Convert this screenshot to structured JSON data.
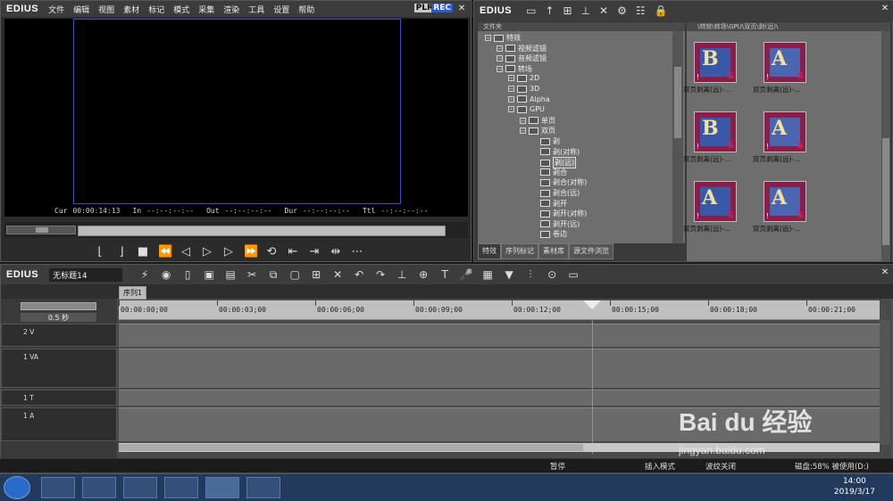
{
  "player": {
    "logo": "EDIUS",
    "menu": [
      "文件",
      "编辑",
      "视图",
      "素材",
      "标记",
      "模式",
      "采集",
      "渲染",
      "工具",
      "设置",
      "帮助"
    ],
    "plr": "PLR",
    "rec": "REC",
    "timecodes": {
      "cur_label": "Cur",
      "cur": "00:00:14:13",
      "in_label": "In",
      "in": "--:--:--:--",
      "out_label": "Out",
      "out": "--:--:--:--",
      "dur_label": "Dur",
      "dur": "--:--:--:--",
      "ttl_label": "Ttl",
      "ttl": "--:--:--:--"
    }
  },
  "library": {
    "logo": "EDIUS",
    "tree_header": "文件夹",
    "tree": [
      {
        "label": "特效",
        "indent": 0
      },
      {
        "label": "视频滤镜",
        "indent": 1
      },
      {
        "label": "音频滤镜",
        "indent": 1
      },
      {
        "label": "转场",
        "indent": 1
      },
      {
        "label": "2D",
        "indent": 2
      },
      {
        "label": "3D",
        "indent": 2
      },
      {
        "label": "Alpha",
        "indent": 2
      },
      {
        "label": "GPU",
        "indent": 2
      },
      {
        "label": "单页",
        "indent": 3
      },
      {
        "label": "双页",
        "indent": 3
      },
      {
        "label": "剥",
        "indent": 4
      },
      {
        "label": "剥(对称)",
        "indent": 4
      },
      {
        "label": "剥(远)",
        "indent": 4,
        "selected": true
      },
      {
        "label": "剥合",
        "indent": 4
      },
      {
        "label": "剥合(对称)",
        "indent": 4
      },
      {
        "label": "剥合(远)",
        "indent": 4
      },
      {
        "label": "剥开",
        "indent": 4
      },
      {
        "label": "剥开(对称)",
        "indent": 4
      },
      {
        "label": "剥开(远)",
        "indent": 4
      },
      {
        "label": "卷边",
        "indent": 4
      }
    ],
    "tabs": [
      "特效",
      "序列标记",
      "素材库",
      "源文件浏览"
    ],
    "bin_path": "\\特效\\转场\\GPU\\双页\\剥(远)\\",
    "thumbs": [
      {
        "letter": "B",
        "label": "双页剥离(远)-..."
      },
      {
        "letter": "A",
        "label": "双页剥离(远)-..."
      },
      {
        "letter": "B",
        "label": "双页剥离(远)-..."
      },
      {
        "letter": "A",
        "label": "双页剥离(远)-..."
      },
      {
        "letter": "A",
        "label": "双页剥离(远)-..."
      },
      {
        "letter": "A",
        "label": "双页剥离(远)-..."
      }
    ]
  },
  "timeline": {
    "logo": "EDIUS",
    "project_name": "无标题14",
    "sequence_tab": "序列1",
    "zoom": "0.5 秒",
    "ruler": [
      "00:00:00;00",
      "00:00:03;00",
      "00:00:06;00",
      "00:00:09;00",
      "00:00:12;00",
      "00:00:15;00",
      "00:00:18;00",
      "00:00:21;00"
    ],
    "tracks": [
      {
        "name": "2 V"
      },
      {
        "name": "1 VA"
      },
      {
        "name": "1 T"
      },
      {
        "name": "1 A"
      }
    ],
    "status": {
      "pause": "暂停",
      "insert_mode": "插入模式",
      "ripple_off": "波纹关闭",
      "disk": "磁盘:58% 被使用(D:)"
    }
  },
  "taskbar": {
    "time": "14:00",
    "date": "2019/3/17"
  },
  "watermark": {
    "brand": "Bai du 经验",
    "url": "jingyan.baidu.com"
  }
}
